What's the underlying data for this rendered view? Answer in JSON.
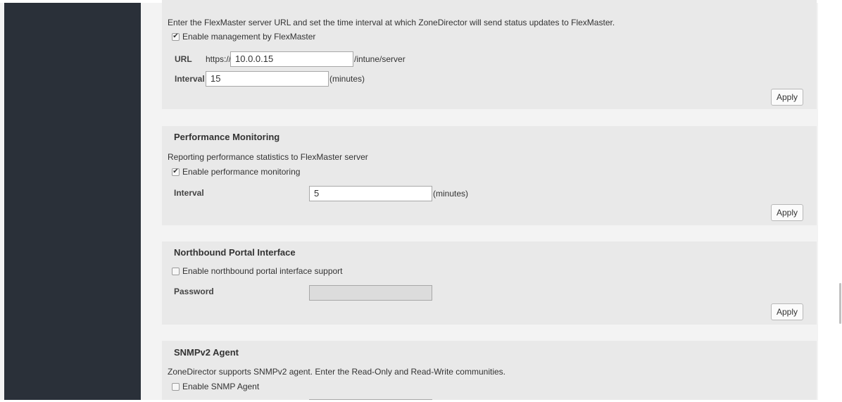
{
  "flexmaster": {
    "description": "Enter the FlexMaster server URL and set the time interval at which ZoneDirector will send status updates to FlexMaster.",
    "enable_checked": true,
    "enable_label": "Enable management by FlexMaster",
    "url_label": "URL",
    "url_prefix": "https://",
    "url_value": "10.0.0.15",
    "url_suffix": "/intune/server",
    "interval_label": "Interval",
    "interval_value": "15",
    "interval_unit": "(minutes)",
    "apply_label": "Apply"
  },
  "performance": {
    "title": "Performance Monitoring",
    "description": "Reporting performance statistics to FlexMaster server",
    "enable_checked": true,
    "enable_label": "Enable performance monitoring",
    "interval_label": "Interval",
    "interval_value": "5",
    "interval_unit": "(minutes)",
    "apply_label": "Apply"
  },
  "northbound": {
    "title": "Northbound Portal Interface",
    "enable_checked": false,
    "enable_label": "Enable northbound portal interface support",
    "password_label": "Password",
    "password_value": "",
    "apply_label": "Apply"
  },
  "snmp": {
    "title": "SNMPv2 Agent",
    "description": "ZoneDirector supports SNMPv2 agent. Enter the Read-Only and Read-Write communities.",
    "enable_checked": false,
    "enable_label": "Enable SNMP Agent"
  },
  "colors": {
    "sidebar": "#2a3039",
    "panel": "#e9e9e9",
    "page": "#f3f3f3"
  }
}
